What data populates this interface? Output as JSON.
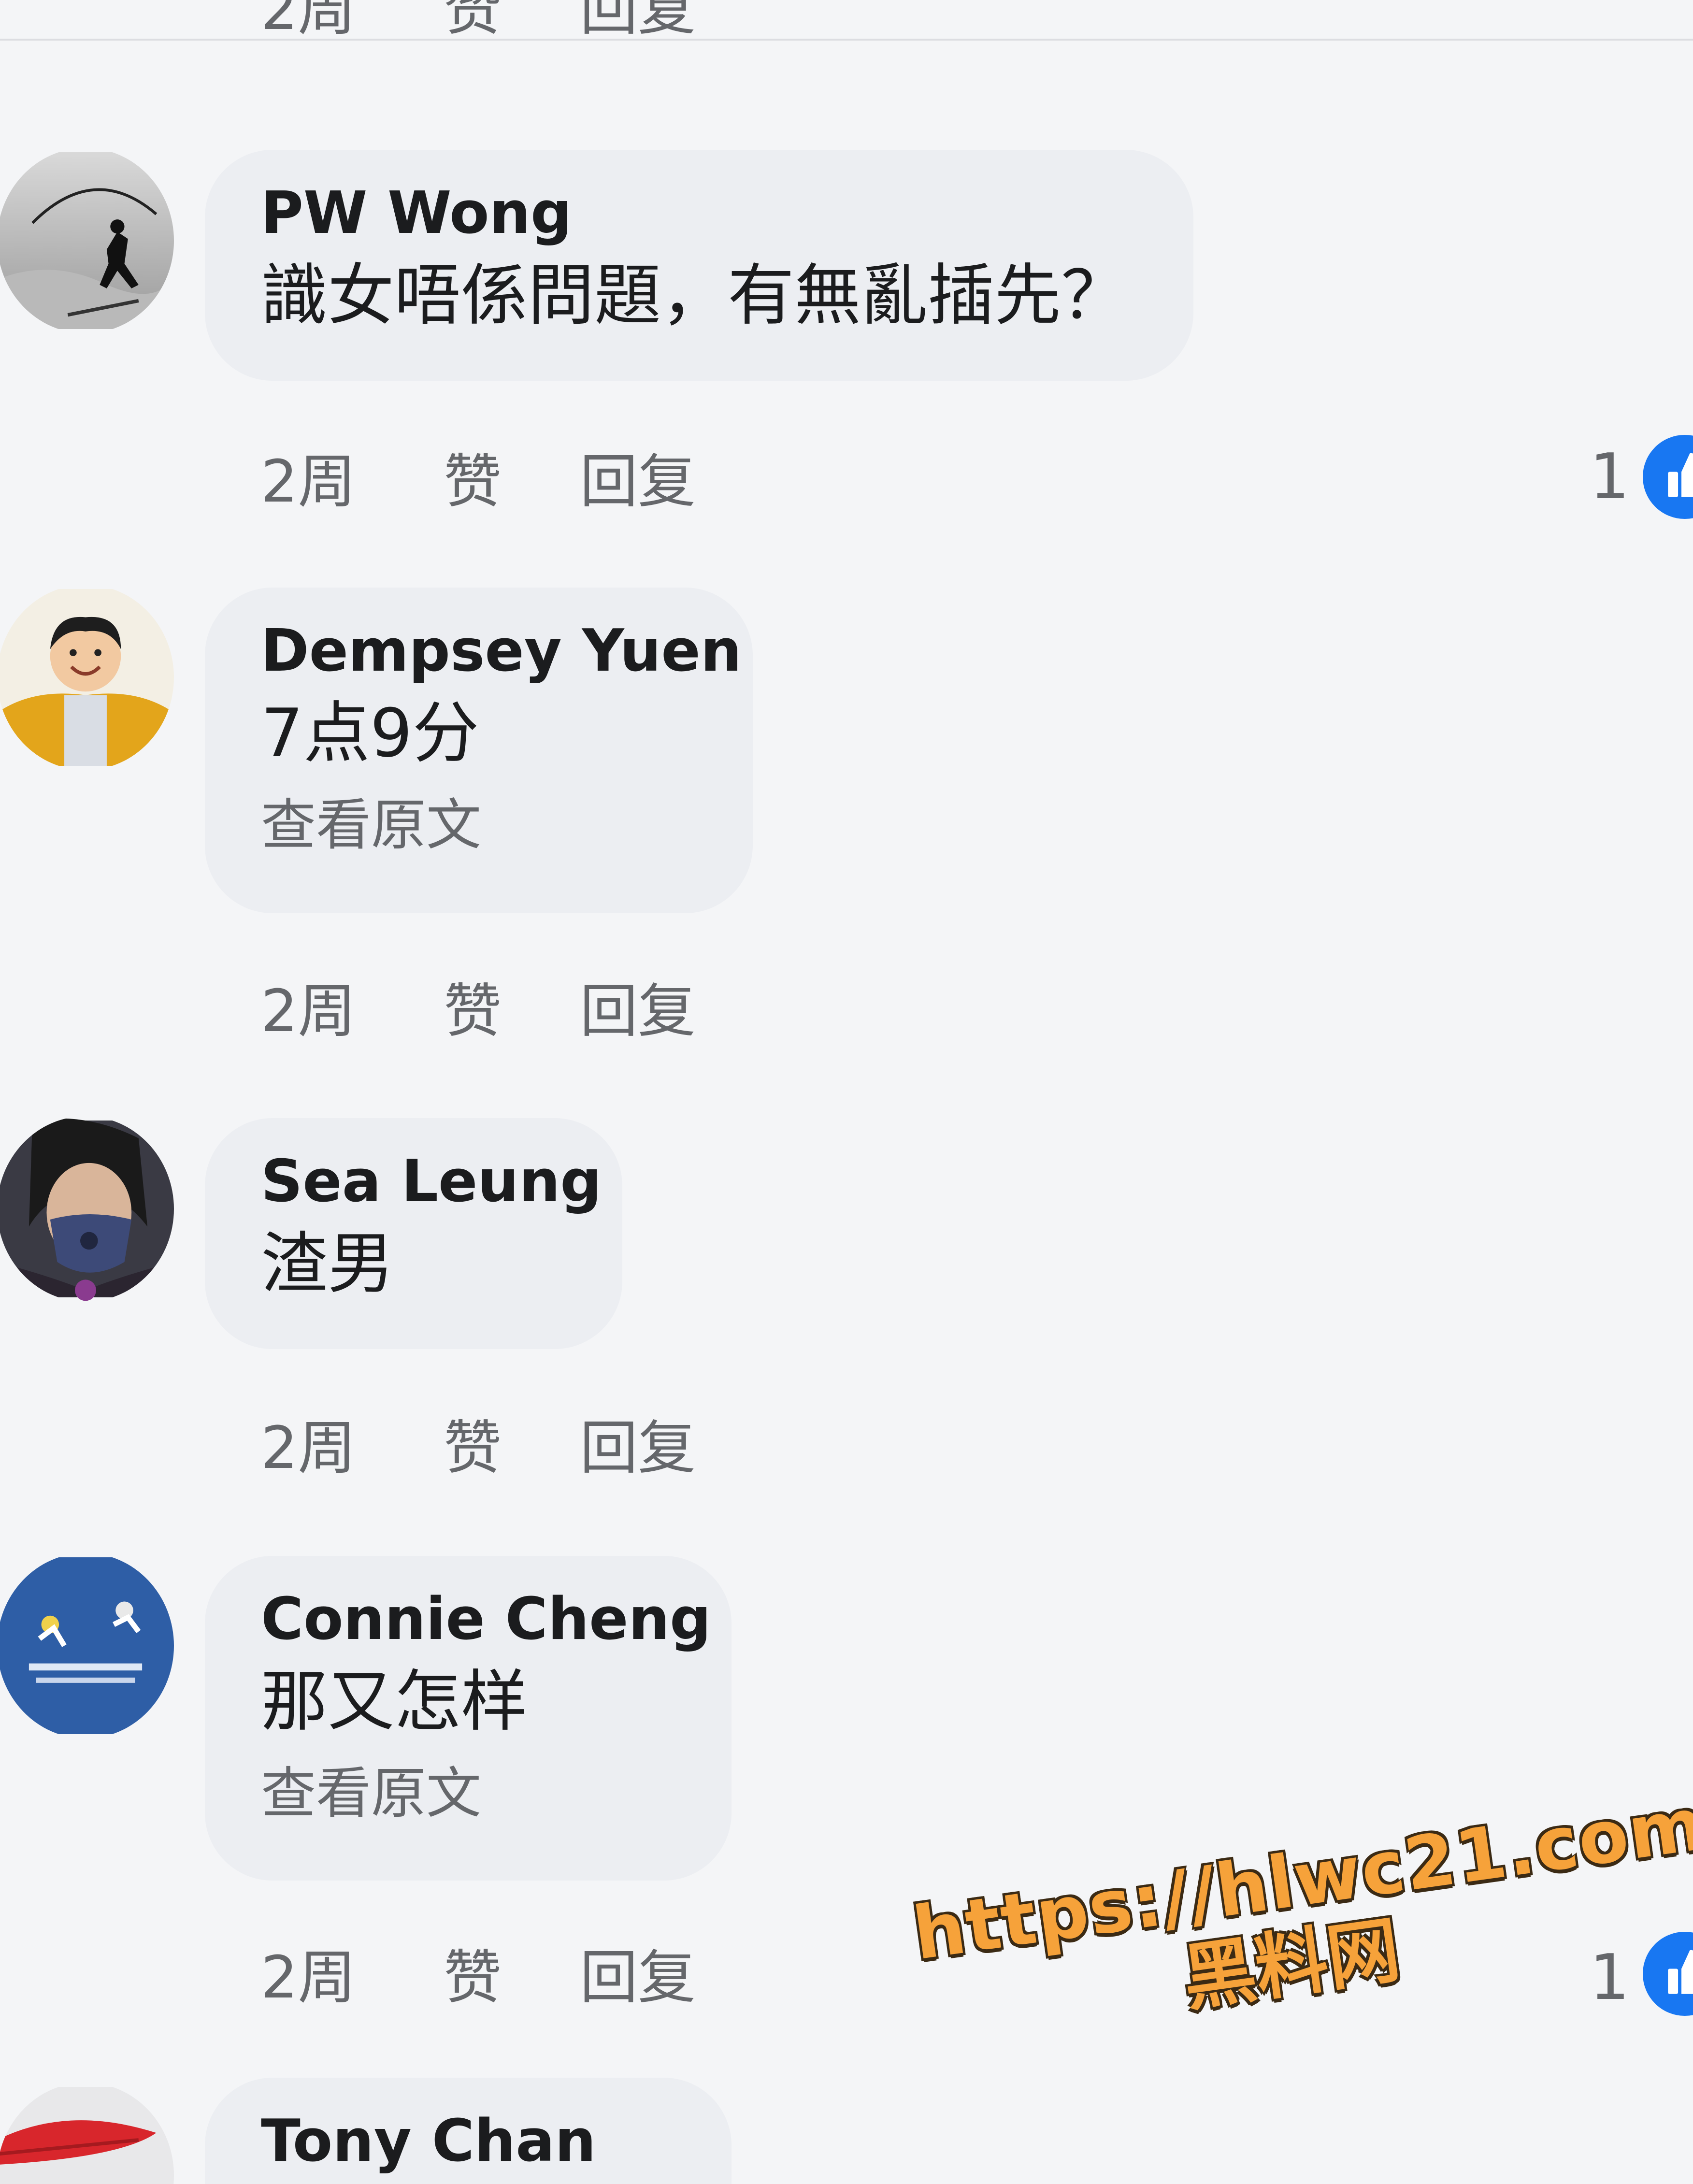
{
  "comments": [
    {
      "author": "PW Wong",
      "text": "識女唔係問題，有無亂插先？",
      "see_original": "",
      "time": "2周",
      "like_label": "赞",
      "reply_label": "回复",
      "reaction_count": "1"
    },
    {
      "author": "Dempsey Yuen",
      "text": "7点9分",
      "see_original": "查看原文",
      "time": "2周",
      "like_label": "赞",
      "reply_label": "回复",
      "reaction_count": ""
    },
    {
      "author": "Sea Leung",
      "text": "渣男",
      "see_original": "",
      "time": "2周",
      "like_label": "赞",
      "reply_label": "回复",
      "reaction_count": ""
    },
    {
      "author": "Connie Cheng",
      "text": "那又怎样",
      "see_original": "查看原文",
      "time": "2周",
      "like_label": "赞",
      "reply_label": "回复",
      "reaction_count": "1"
    },
    {
      "author": "Tony Chan",
      "text": "",
      "see_original": "",
      "time": "",
      "like_label": "",
      "reply_label": "",
      "reaction_count": ""
    }
  ],
  "previous_actions": {
    "time": "2周",
    "like_label": "赞",
    "reply_label": "回复"
  },
  "watermark": {
    "url": "https://hlwc21.com",
    "name": "黑料网"
  },
  "colors": {
    "bubble": "#eceef2",
    "background": "#f4f5f7",
    "meta_text": "#65676b",
    "like_blue": "#1877f2",
    "watermark": "#f6a23a"
  }
}
